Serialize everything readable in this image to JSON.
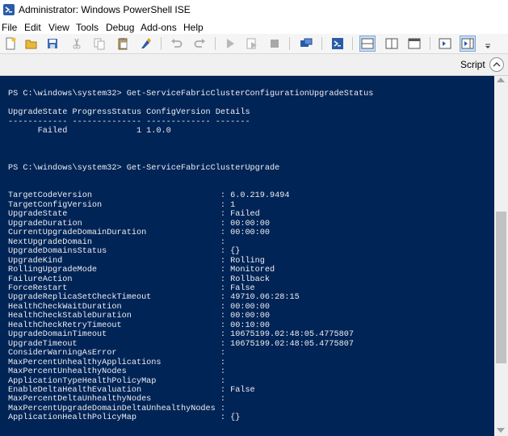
{
  "window": {
    "title": "Administrator: Windows PowerShell ISE"
  },
  "menu": {
    "items": [
      "File",
      "Edit",
      "View",
      "Tools",
      "Debug",
      "Add-ons",
      "Help"
    ]
  },
  "toolbar": {
    "icons": [
      "new-file-icon",
      "open-folder-icon",
      "save-icon",
      "cut-icon",
      "copy-icon",
      "paste-icon",
      "clear-console-icon",
      "undo-icon",
      "redo-icon",
      "run-script-icon",
      "run-selection-icon",
      "stop-icon",
      "remote-powershell-icon",
      "powershell-console-icon",
      "show-script-pane-top-icon",
      "show-script-pane-right-icon",
      "show-script-pane-maximized-icon",
      "show-commands-icon",
      "show-command-addon-icon"
    ]
  },
  "script_pane": {
    "label": "Script"
  },
  "console": {
    "commands": [
      {
        "prompt": "PS C:\\windows\\system32>",
        "command": "Get-ServiceFabricClusterConfigurationUpgradeStatus"
      },
      {
        "prompt": "PS C:\\windows\\system32>",
        "command": "Get-ServiceFabricClusterUpgrade"
      }
    ],
    "table": {
      "headers": [
        "UpgradeState",
        "ProgressStatus",
        "ConfigVersion",
        "Details"
      ],
      "row": [
        "Failed",
        "1",
        "1.0.0",
        ""
      ]
    },
    "properties": [
      [
        "TargetCodeVersion",
        "6.0.219.9494"
      ],
      [
        "TargetConfigVersion",
        "1"
      ],
      [
        "UpgradeState",
        "Failed"
      ],
      [
        "UpgradeDuration",
        "00:00:00"
      ],
      [
        "CurrentUpgradeDomainDuration",
        "00:00:00"
      ],
      [
        "NextUpgradeDomain",
        ""
      ],
      [
        "UpgradeDomainsStatus",
        "{}"
      ],
      [
        "UpgradeKind",
        "Rolling"
      ],
      [
        "RollingUpgradeMode",
        "Monitored"
      ],
      [
        "FailureAction",
        "Rollback"
      ],
      [
        "ForceRestart",
        "False"
      ],
      [
        "UpgradeReplicaSetCheckTimeout",
        "49710.06:28:15"
      ],
      [
        "HealthCheckWaitDuration",
        "00:00:00"
      ],
      [
        "HealthCheckStableDuration",
        "00:00:00"
      ],
      [
        "HealthCheckRetryTimeout",
        "00:10:00"
      ],
      [
        "UpgradeDomainTimeout",
        "10675199.02:48:05.4775807"
      ],
      [
        "UpgradeTimeout",
        "10675199.02:48:05.4775807"
      ],
      [
        "ConsiderWarningAsError",
        ""
      ],
      [
        "MaxPercentUnhealthyApplications",
        ""
      ],
      [
        "MaxPercentUnhealthyNodes",
        ""
      ],
      [
        "ApplicationTypeHealthPolicyMap",
        ""
      ],
      [
        "EnableDeltaHealthEvaluation",
        "False"
      ],
      [
        "MaxPercentDeltaUnhealthyNodes",
        ""
      ],
      [
        "MaxPercentUpgradeDomainDeltaUnhealthyNodes",
        ""
      ],
      [
        "ApplicationHealthPolicyMap",
        "{}"
      ]
    ]
  },
  "colors": {
    "console_bg": "#012456",
    "console_fg": "#eeedf0",
    "scroll_thumb": "#c2c2c2"
  }
}
